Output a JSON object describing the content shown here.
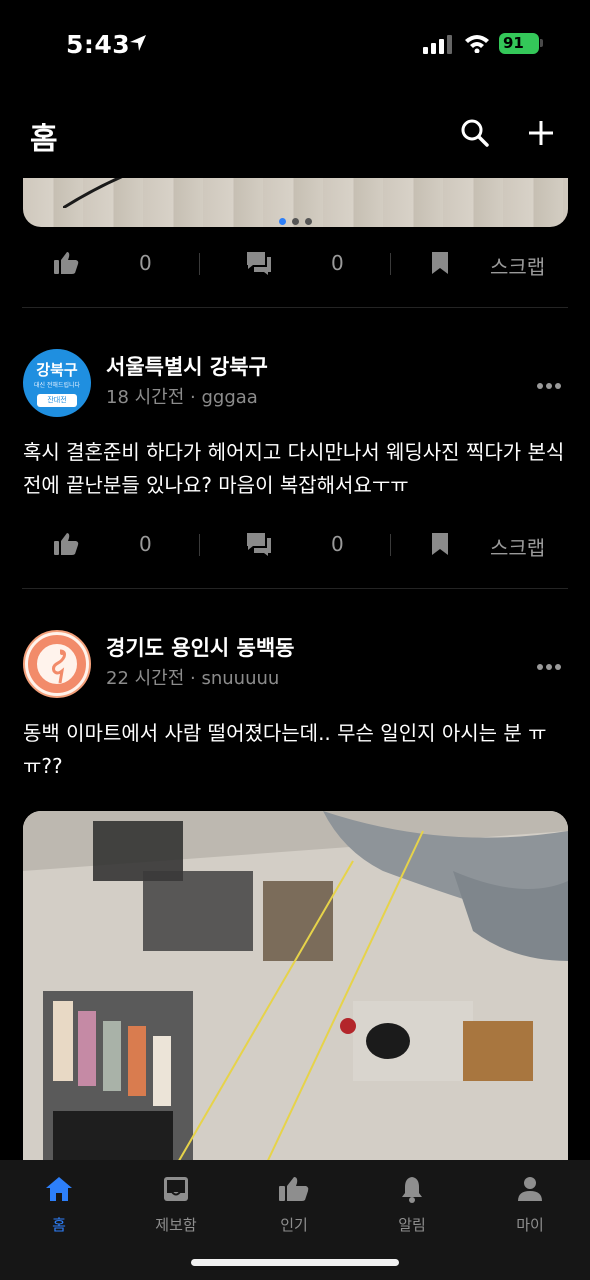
{
  "status_bar": {
    "time": "5:43",
    "battery": "91",
    "icons": [
      "location-arrow-icon",
      "signal-icon",
      "wifi-icon",
      "battery-icon"
    ]
  },
  "header": {
    "title": "홈",
    "icons": [
      "search-icon",
      "plus-icon"
    ]
  },
  "colors": {
    "accent": "#2d7ff9",
    "background": "#000000",
    "tabbar": "#161616",
    "battery": "#34c759"
  },
  "feed": {
    "carousel": {
      "total_images": 3,
      "active_index": 0
    },
    "post0_actions": {
      "likes": "0",
      "comments": "0",
      "scrap_label": "스크랩"
    },
    "posts": [
      {
        "avatar": {
          "line1": "강북구",
          "line2": "대신 전해드립니다",
          "badge": "잔대전"
        },
        "region": "서울특별시 강북구",
        "time": "18 시간전",
        "author": "gggaa",
        "text": "혹시 결혼준비 하다가 헤어지고 다시만나서 웨딩사진 찍다가 본식전에 끝난분들 있나요? 마음이 복잡해서요ㅜㅠ",
        "likes": "0",
        "comments": "0",
        "scrap_label": "스크랩"
      },
      {
        "region": "경기도 용인시 동백동",
        "time": "22 시간전",
        "author": "snuuuuu",
        "text": "동백 이마트에서 사람 떨어졌다는데.. 무슨 일인지 아시는 분 ㅠㅠ??"
      }
    ]
  },
  "tabbar": {
    "items": [
      {
        "label": "홈",
        "icon": "home-icon",
        "active": true
      },
      {
        "label": "제보함",
        "icon": "inbox-icon",
        "active": false
      },
      {
        "label": "인기",
        "icon": "thumbs-up-icon",
        "active": false
      },
      {
        "label": "알림",
        "icon": "bell-icon",
        "active": false
      },
      {
        "label": "마이",
        "icon": "person-icon",
        "active": false
      }
    ]
  }
}
